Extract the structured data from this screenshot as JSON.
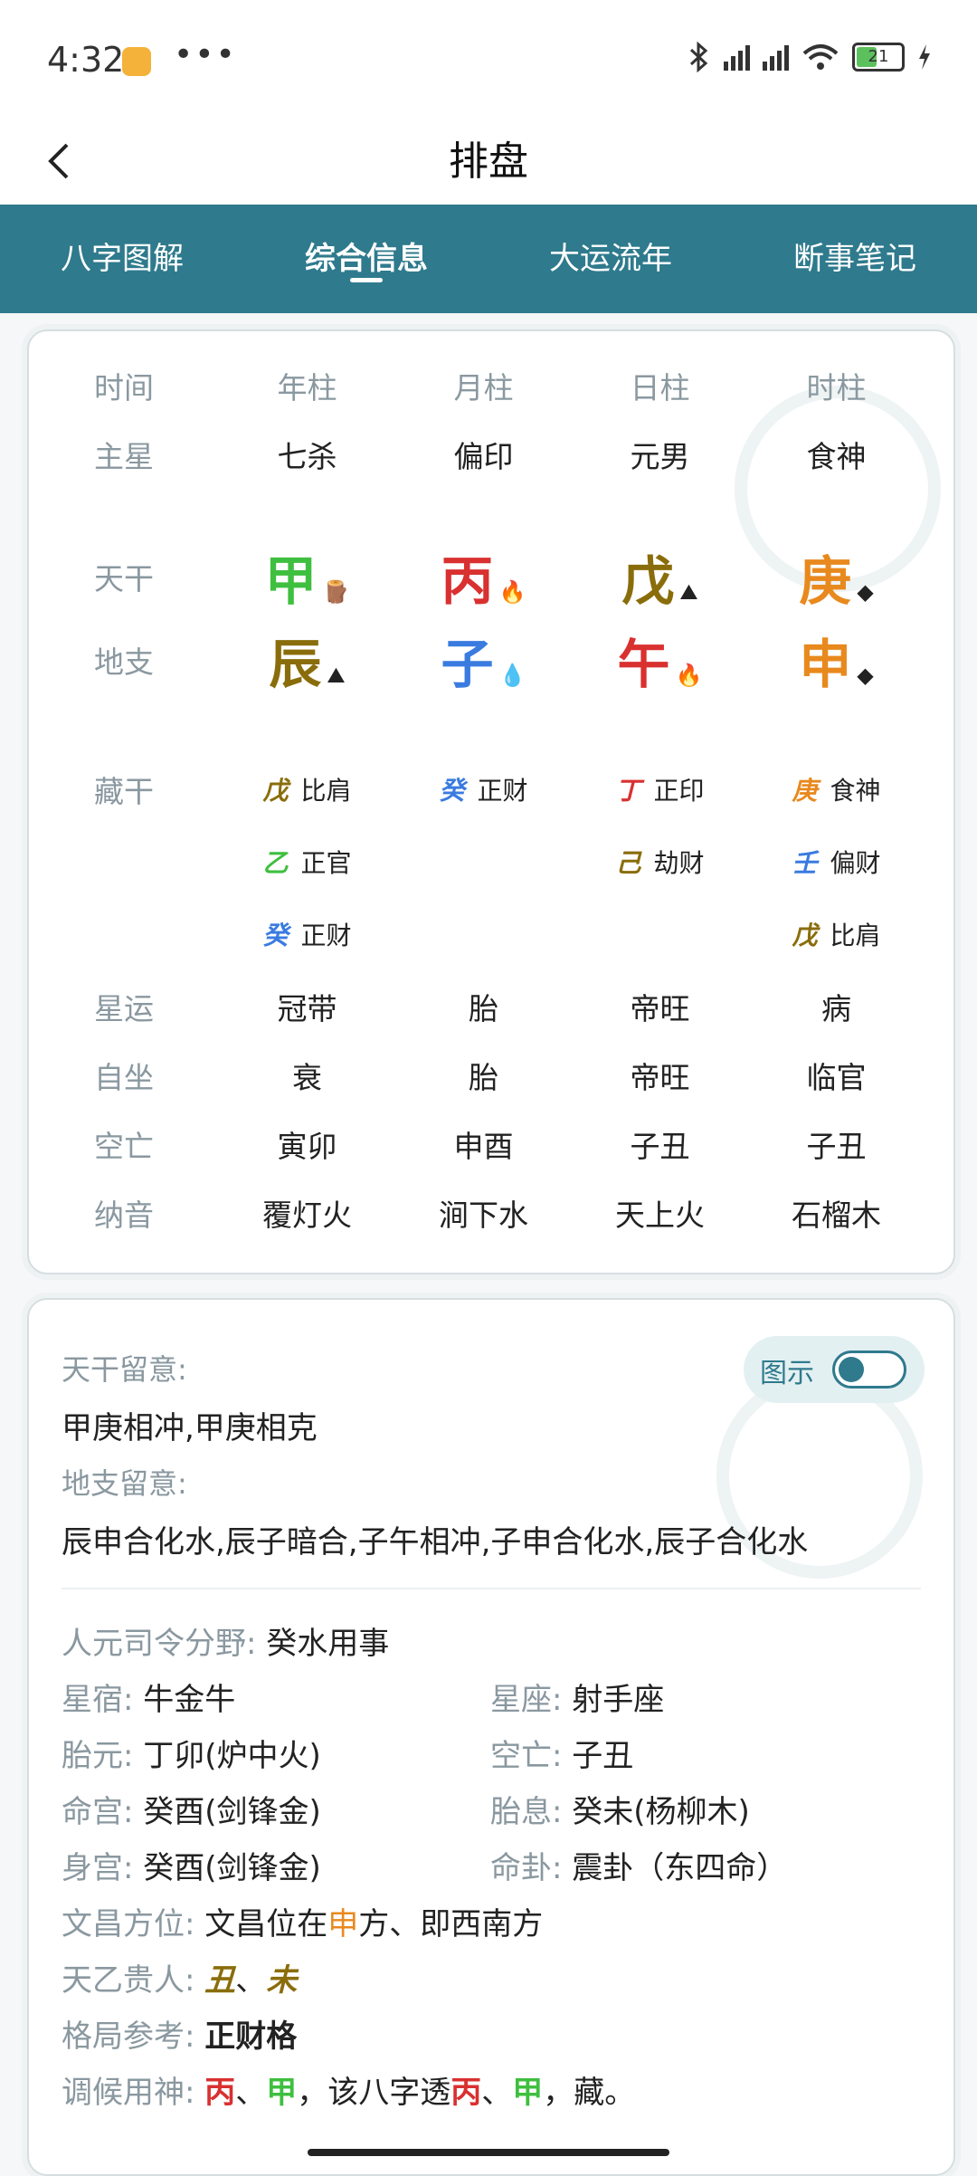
{
  "status": {
    "time": "4:32",
    "dots": "•••",
    "battery": "21"
  },
  "header": {
    "title": "排盘"
  },
  "tabs": [
    "八字图解",
    "综合信息",
    "大运流年",
    "断事笔记"
  ],
  "colors": {
    "jia": "#3fbf3f",
    "bing": "#d93030",
    "wu": "#8a6d0b",
    "geng": "#e8891e",
    "zi": "#3a7be0",
    "accent": "#2f7a8d"
  },
  "pillars": {
    "header": {
      "label": "时间",
      "cols": [
        "年柱",
        "月柱",
        "日柱",
        "时柱"
      ]
    },
    "main_star": {
      "label": "主星",
      "cols": [
        "七杀",
        "偏印",
        "元男",
        "食神"
      ]
    },
    "tiangan": {
      "label": "天干",
      "cols": [
        "甲",
        "丙",
        "戊",
        "庚"
      ]
    },
    "dizhi": {
      "label": "地支",
      "cols": [
        "辰",
        "子",
        "午",
        "申"
      ]
    },
    "canggan": {
      "label": "藏干",
      "col1": [
        {
          "g": "戊",
          "s": "比肩"
        },
        {
          "g": "乙",
          "s": "正官"
        },
        {
          "g": "癸",
          "s": "正财"
        }
      ],
      "col2": [
        {
          "g": "癸",
          "s": "正财"
        }
      ],
      "col3": [
        {
          "g": "丁",
          "s": "正印"
        },
        {
          "g": "己",
          "s": "劫财"
        }
      ],
      "col4": [
        {
          "g": "庚",
          "s": "食神"
        },
        {
          "g": "壬",
          "s": "偏财"
        },
        {
          "g": "戊",
          "s": "比肩"
        }
      ]
    },
    "xingyun": {
      "label": "星运",
      "cols": [
        "冠带",
        "胎",
        "帝旺",
        "病"
      ]
    },
    "zizuo": {
      "label": "自坐",
      "cols": [
        "衰",
        "胎",
        "帝旺",
        "临官"
      ]
    },
    "kongwang": {
      "label": "空亡",
      "cols": [
        "寅卯",
        "申酉",
        "子丑",
        "子丑"
      ]
    },
    "nayin": {
      "label": "纳音",
      "cols": [
        "覆灯火",
        "涧下水",
        "天上火",
        "石榴木"
      ]
    }
  },
  "info": {
    "tiangan_note_label": "天干留意:",
    "tiangan_note": "甲庚相冲,甲庚相克",
    "dizhi_note_label": "地支留意:",
    "dizhi_note": "辰申合化水,辰子暗合,子午相冲,子申合化水,辰子合化水",
    "toggle_label": "图示",
    "renyuan_label": "人元司令分野:",
    "renyuan": "癸水用事",
    "xingxiu_label": "星宿:",
    "xingxiu": "牛金牛",
    "xingzuo_label": "星座:",
    "xingzuo": "射手座",
    "taiyuan_label": "胎元:",
    "taiyuan": "丁卯(炉中火)",
    "kongwang_label": "空亡:",
    "kongwang": "子丑",
    "minggong_label": "命宫:",
    "minggong": "癸酉(剑锋金)",
    "taixi_label": "胎息:",
    "taixi": "癸未(杨柳木)",
    "shengong_label": "身宫:",
    "shengong": "癸酉(剑锋金)",
    "minggua_label": "命卦:",
    "minggua": "震卦（东四命）",
    "wenchang_label": "文昌方位:",
    "wenchang_pre": "文昌位在",
    "wenchang_hl": "申",
    "wenchang_post": "方、即西南方",
    "tianyi_label": "天乙贵人:",
    "tianyi_a": "丑",
    "tianyi_sep": "、",
    "tianyi_b": "未",
    "geju_label": "格局参考:",
    "geju": "正财格",
    "tiaohou_label": "调候用神:",
    "tiaohou_a": "丙",
    "tiaohou_sep1": "、",
    "tiaohou_b": "甲",
    "tiaohou_mid": "，该八字透",
    "tiaohou_c": "丙",
    "tiaohou_sep2": "、",
    "tiaohou_d": "甲",
    "tiaohou_end": "，藏。"
  }
}
